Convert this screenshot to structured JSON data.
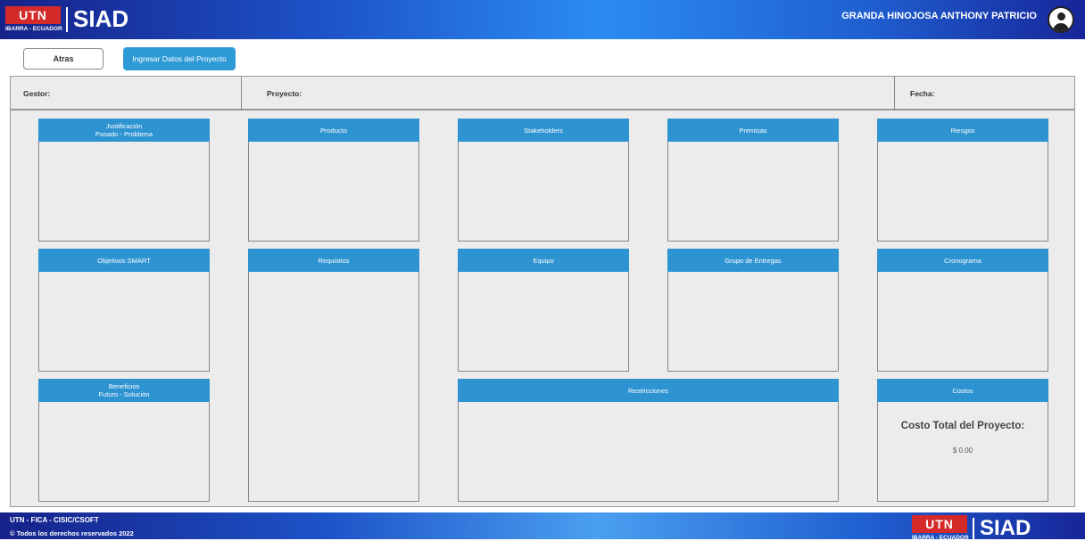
{
  "header": {
    "logo_mark": "UTN",
    "logo_sub": "IBARRA - ECUADOR",
    "app_name": "SIAD",
    "user_name": "GRANDA HINOJOSA ANTHONY PATRICIO"
  },
  "toolbar": {
    "back_label": "Atras",
    "ingresar_label": "Ingresar Datos del Proyecto"
  },
  "info": {
    "gestor_label": "Gestor:",
    "proyecto_label": "Proyecto:",
    "fecha_label": "Fecha:"
  },
  "cards": {
    "justificacion": {
      "line1": "Justificación",
      "line2": "Pasado - Problema"
    },
    "producto": {
      "line1": "Producto"
    },
    "stakeholders": {
      "line1": "Stakeholders"
    },
    "premisas": {
      "line1": "Premisas"
    },
    "riesgos": {
      "line1": "Riesgos"
    },
    "objetivos": {
      "line1": "Objetivos SMART"
    },
    "requisitos": {
      "line1": "Requisitos"
    },
    "equipo": {
      "line1": "Equipo"
    },
    "entregas": {
      "line1": "Grupo de Entregas"
    },
    "cronograma": {
      "line1": "Cronograma"
    },
    "beneficios": {
      "line1": "Beneficios",
      "line2": "Futuro - Solución"
    },
    "restricciones": {
      "line1": "Restricciones"
    },
    "costos": {
      "line1": "Costos",
      "total_label": "Costo Total del Proyecto:",
      "total_value": "$ 0.00"
    }
  },
  "footer": {
    "line1": "UTN - FICA - CISIC/CSOFT",
    "line2": "© Todos los derechos reservados 2022",
    "logo_mark": "UTN",
    "logo_sub": "IBARRA - ECUADOR",
    "app_name": "SIAD"
  },
  "colors": {
    "brand_blue": "#2e93d1",
    "utn_red": "#d42a2a",
    "header_dark": "#16228a"
  }
}
